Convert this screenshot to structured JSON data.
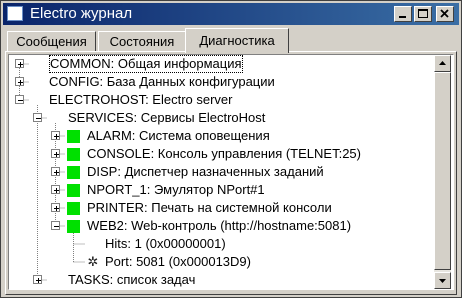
{
  "window": {
    "title": "Electro журнал",
    "buttons": {
      "minimize_icon": "minimize-icon",
      "maximize_icon": "maximize-icon",
      "close_icon": "close-icon"
    }
  },
  "tabs": [
    {
      "label": "Сообщения",
      "active": false
    },
    {
      "label": "Состояния",
      "active": false
    },
    {
      "label": "Диагностика",
      "active": true
    }
  ],
  "colors": {
    "titlebar_start": "#0a246a",
    "titlebar_end": "#3a6ea5",
    "status_ok": "#00e000",
    "window_face": "#d4d0c8"
  },
  "tree": {
    "items": [
      {
        "label": "COMMON: Общая информация",
        "expander": "plus",
        "selected": true
      },
      {
        "label": "CONFIG: База Данных конфигурации",
        "expander": "plus"
      },
      {
        "label": "ELECTROHOST: Electro server",
        "expander": "minus"
      },
      {
        "label": "SERVICES: Сервисы ElectroHost",
        "expander": "minus"
      },
      {
        "label": "ALARM: Система оповещения",
        "expander": "plus",
        "status": "ok"
      },
      {
        "label": "CONSOLE: Консоль управления (TELNET:25)",
        "expander": "plus",
        "status": "ok"
      },
      {
        "label": "DISP: Диспетчер назначенных заданий",
        "expander": "plus",
        "status": "ok"
      },
      {
        "label": "NPORT_1: Эмулятор NPort#1",
        "expander": "plus",
        "status": "ok"
      },
      {
        "label": "PRINTER: Печать на системной консоли",
        "expander": "plus",
        "status": "ok"
      },
      {
        "label": "WEB2: Web-контроль (http://hostname:5081)",
        "expander": "minus",
        "status": "ok"
      },
      {
        "label": "Hits: 1 (0x00000001)"
      },
      {
        "label": "Port: 5081 (0x000013D9)",
        "icon": "gear-icon"
      },
      {
        "label": "TASKS: список задач",
        "expander": "plus"
      }
    ]
  }
}
